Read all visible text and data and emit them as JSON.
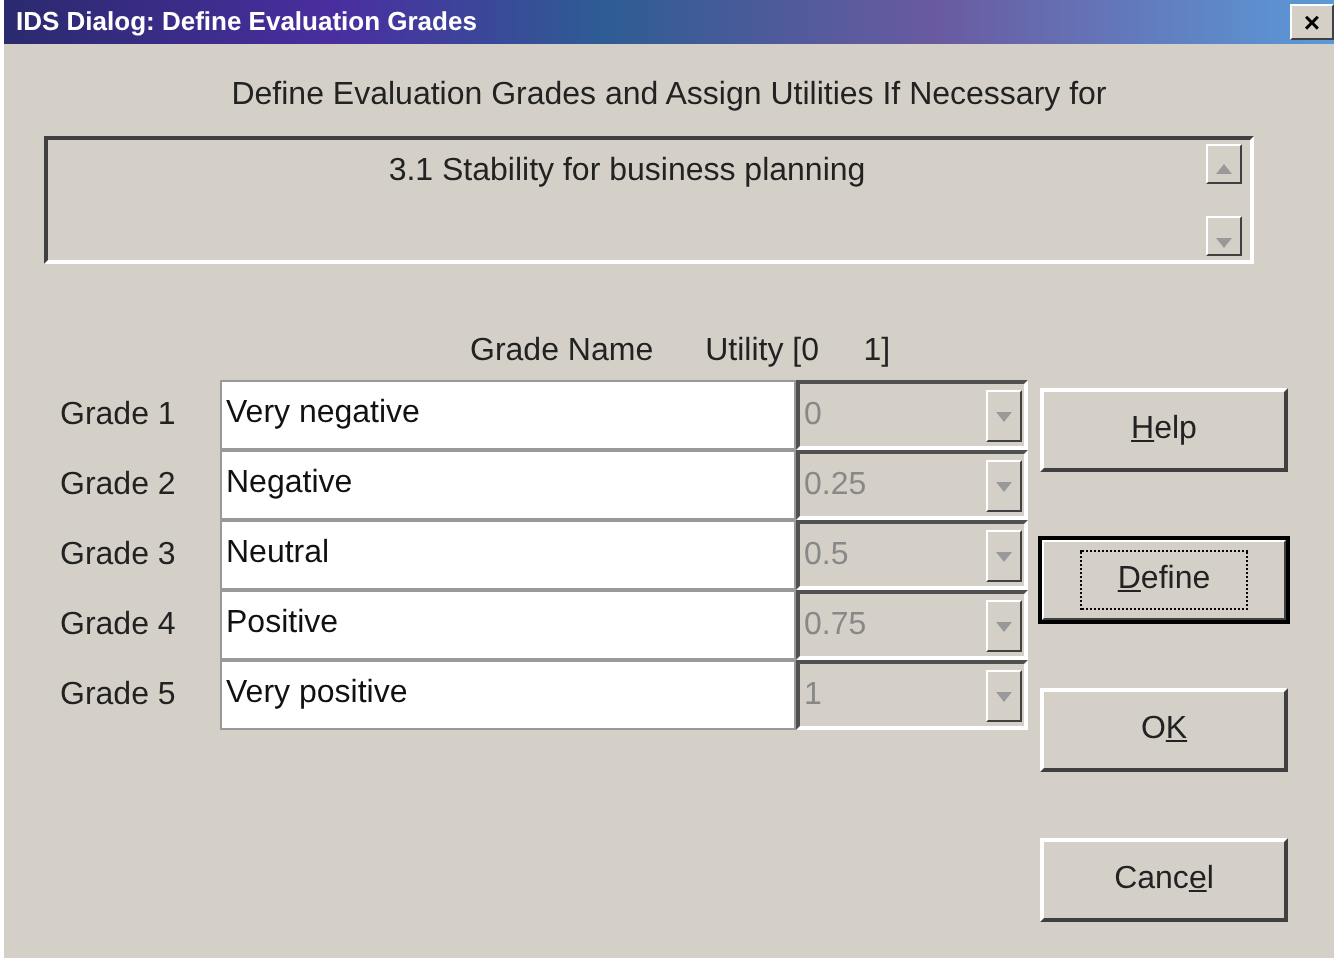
{
  "window": {
    "title": "IDS Dialog: Define Evaluation Grades",
    "close": "×"
  },
  "heading": "Define Evaluation Grades and Assign Utilities If Necessary for",
  "criterion": {
    "value": "3.1 Stability for business planning"
  },
  "columns": {
    "name": "Grade Name",
    "utility": "Utility [0     1]"
  },
  "grades": [
    {
      "label": "Grade 1",
      "name": "Very negative",
      "utility": "0",
      "utility_disabled": true
    },
    {
      "label": "Grade 2",
      "name": "Negative",
      "utility": "0.25",
      "utility_disabled": true
    },
    {
      "label": "Grade 3",
      "name": "Neutral",
      "utility": "0.5",
      "utility_disabled": true
    },
    {
      "label": "Grade 4",
      "name": "Positive",
      "utility": "0.75",
      "utility_disabled": true
    },
    {
      "label": "Grade 5",
      "name": "Very positive",
      "utility": "1",
      "utility_disabled": true
    }
  ],
  "buttons": [
    {
      "key": "H",
      "after": "elp",
      "focused": false
    },
    {
      "key": "D",
      "after": "efine",
      "focused": true
    },
    {
      "before": "O",
      "key": "K",
      "focused": false
    },
    {
      "before": "Canc",
      "key": "e",
      "after": "l",
      "focused": false
    }
  ]
}
